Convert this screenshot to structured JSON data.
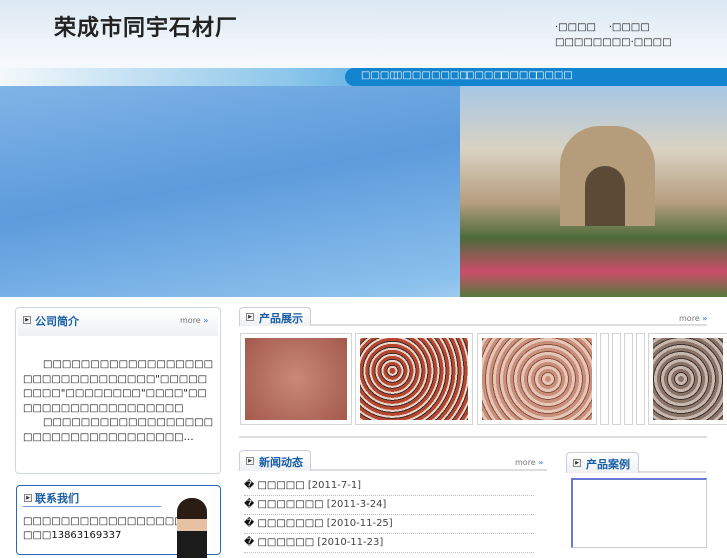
{
  "header": {
    "logo": "荣成市同宇石材厂",
    "top_links": [
      "·□□□□",
      "·□□□□"
    ],
    "top_text": "□□□□□□□□·□□□□"
  },
  "nav": {
    "items": [
      "□□□□",
      "□□□□",
      "□□□□",
      "□□□□",
      "□□□□",
      "□□□□"
    ]
  },
  "intro": {
    "title": "公司简介",
    "more": "more",
    "para1": "　　□□□□□□□□□□□□□□□□□□□□□□□□□□□□□□□□\"□□□□□□□□□\"□□□□□□□□\"□□□□\"□□□□□□□□□□□□□□□□□□□",
    "para2": "　　□□□□□□□□□□□□□□□□□□□□□□□□□□□□□□□□□□□…"
  },
  "contact": {
    "title": "联系我们",
    "line1": "□□□□□□□□□□□□□□□□□",
    "phone": "□□□13863169337"
  },
  "products": {
    "title": "产品展示",
    "more": "more",
    "colors": [
      "#b86a5a",
      "#b8452d",
      "#c98f7a",
      "#8a7468"
    ]
  },
  "news": {
    "title": "新闻动态",
    "more": "more",
    "items": [
      {
        "bullet": "�",
        "title": "□□□□□",
        "date": "[2011-7-1]"
      },
      {
        "bullet": "�",
        "title": "□□□□□□□",
        "date": "[2011-3-24]"
      },
      {
        "bullet": "�",
        "title": "□□□□□□□",
        "date": "[2010-11-25]"
      },
      {
        "bullet": "�",
        "title": "□□□□□□",
        "date": "[2010-11-23]"
      }
    ]
  },
  "cases": {
    "title": "产品案例"
  }
}
